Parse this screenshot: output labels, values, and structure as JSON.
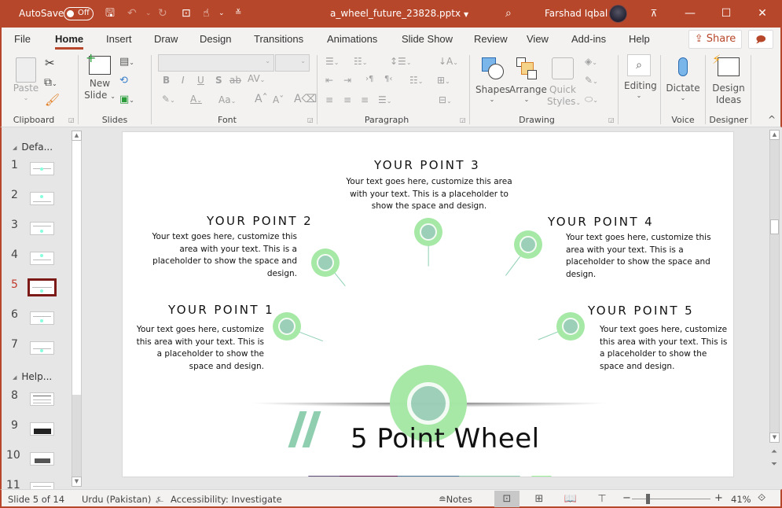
{
  "titlebar": {
    "autosave_label": "AutoSave",
    "autosave_state": "Off",
    "filename": "a_wheel_future_23828.pptx",
    "user_name": "Farshad Iqbal",
    "icons": [
      "save-icon",
      "undo-icon",
      "redo-icon",
      "present-icon",
      "touch-mode-icon",
      "customize-qat-icon",
      "search-icon",
      "ribbon-display-icon",
      "minimize-icon",
      "maximize-icon",
      "close-icon"
    ]
  },
  "tabs": {
    "items": [
      {
        "label": "File"
      },
      {
        "label": "Home",
        "active": true
      },
      {
        "label": "Insert"
      },
      {
        "label": "Draw"
      },
      {
        "label": "Design"
      },
      {
        "label": "Transitions"
      },
      {
        "label": "Animations"
      },
      {
        "label": "Slide Show"
      },
      {
        "label": "Review"
      },
      {
        "label": "View"
      },
      {
        "label": "Add-ins"
      },
      {
        "label": "Help"
      }
    ],
    "share_label": "Share"
  },
  "ribbon": {
    "clipboard": {
      "label": "Clipboard",
      "paste": "Paste"
    },
    "slides": {
      "label": "Slides",
      "new_slide_line1": "New",
      "new_slide_line2": "Slide"
    },
    "font": {
      "label": "Font",
      "font_name": "",
      "font_size": "",
      "aa_label": "Aa"
    },
    "paragraph": {
      "label": "Paragraph"
    },
    "drawing": {
      "label": "Drawing",
      "shapes": "Shapes",
      "arrange": "Arrange",
      "quick_styles_line1": "Quick",
      "quick_styles_line2": "Styles"
    },
    "editing": {
      "label": "Editing"
    },
    "voice": {
      "label": "Voice",
      "dictate": "Dictate"
    },
    "designer": {
      "label": "Designer",
      "design_ideas_line1": "Design",
      "design_ideas_line2": "Ideas"
    }
  },
  "thumbnails": {
    "sections": [
      {
        "label": "Defa..."
      },
      {
        "label": "Help..."
      }
    ],
    "slides": [
      {
        "num": "1"
      },
      {
        "num": "2"
      },
      {
        "num": "3"
      },
      {
        "num": "4"
      },
      {
        "num": "5",
        "active": true
      },
      {
        "num": "6"
      },
      {
        "num": "7"
      },
      {
        "num": "8"
      },
      {
        "num": "9"
      },
      {
        "num": "10"
      },
      {
        "num": "11"
      }
    ]
  },
  "slide": {
    "title": "5 Point Wheel",
    "points": [
      {
        "heading": "YOUR POINT 1",
        "body_lines": [
          "Your text goes here, customize",
          "this area with your text. This is",
          "a placeholder to show the",
          "space and design."
        ]
      },
      {
        "heading": "YOUR POINT 2",
        "body_lines": [
          "Your text goes here, customize this",
          "area with your text. This is a",
          "placeholder to show the space and",
          "design."
        ]
      },
      {
        "heading": "YOUR POINT 3",
        "body_lines": [
          "Your text goes here, customize this area",
          "with your text. This is a placeholder to",
          "show the space and design."
        ]
      },
      {
        "heading": "YOUR POINT 4",
        "body_lines": [
          "Your text goes here, customize this",
          "area with your text. This is a",
          "placeholder to show the space and",
          "design."
        ]
      },
      {
        "heading": "YOUR POINT 5",
        "body_lines": [
          "Your text goes here, customize",
          "this area with your text. This is",
          "a placeholder to show the",
          "space and design."
        ]
      }
    ],
    "colors": {
      "node_outer": "#a6e8a6",
      "node_inner": "#9ccfb8",
      "accent_line": "#8fd0b4",
      "band": [
        "#5f4b7a",
        "#5a1a4f",
        "#4a7396",
        "#8fcab0",
        "#9ef29e"
      ]
    }
  },
  "statusbar": {
    "slide_info": "Slide 5 of 14",
    "language": "Urdu (Pakistan)",
    "accessibility": "Accessibility: Investigate",
    "notes": "Notes",
    "zoom_level": "41%",
    "zoom_minus": "−",
    "zoom_plus": "+"
  }
}
